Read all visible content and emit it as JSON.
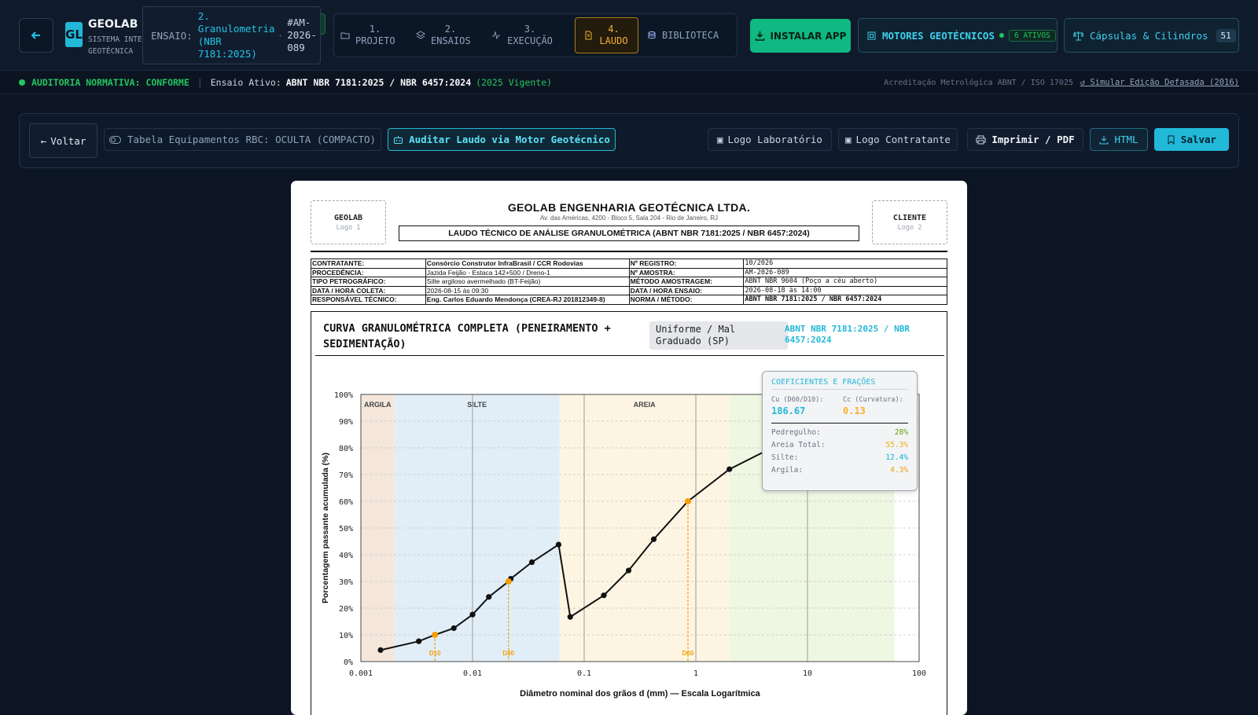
{
  "header": {
    "brand_title": "GEOLAB N",
    "brand_sub1": "SISTEMA INTE",
    "brand_sub2": "GEOTÉCNICA",
    "ensaio_label": "ENSAIO:",
    "ensaio_name": "2. Granulometria (NBR 7181:2025)",
    "ensaio_code": "#AM-2026-089",
    "steps": [
      {
        "label": "1. PROJETO"
      },
      {
        "label": "2. ENSAIOS"
      },
      {
        "label": "3. EXECUÇÃO"
      },
      {
        "label": "4. LAUDO"
      },
      {
        "label": "BIBLIOTECA"
      }
    ],
    "install_label": "INSTALAR APP",
    "motores_label": "MOTORES GEOTÉCNICOS",
    "motores_badge": "6 ATIVOS",
    "capsulas_label": "Cápsulas & Cilindros",
    "capsulas_count": "51"
  },
  "audit": {
    "status": "AUDITORIA NORMATIVA: CONFORME",
    "ensaio_ativo_label": "Ensaio Ativo:",
    "ensaio_ativo_value": "ABNT NBR 7181:2025 / NBR 6457:2024",
    "vigente": "(2025 Vigente)",
    "acreditacao": "Acreditação Metrológica ABNT / ISO 17025",
    "simular": "Simular Edição Defasada (2016)"
  },
  "toolbar": {
    "voltar": "Voltar",
    "tabela": "Tabela Equipamentos RBC: OCULTA (COMPACTO)",
    "auditar": "Auditar Laudo via Motor Geotécnico",
    "logo_lab": "Logo Laboratório",
    "logo_contr": "Logo Contratante",
    "imprimir": "Imprimir / PDF",
    "html": "HTML",
    "salvar": "Salvar"
  },
  "report": {
    "logo1_title": "GEOLAB",
    "logo1_sub": "Logo 1",
    "logo2_title": "CLIENTE",
    "logo2_sub": "Logo 2",
    "company": "GEOLAB ENGENHARIA GEOTÉCNICA LTDA.",
    "address": "Av. das Américas, 4200 - Bloco 5, Sala 204 - Rio de Janeiro, RJ",
    "doc_title": "LAUDO TÉCNICO DE ANÁLISE GRANULOMÉTRICA (ABNT NBR 7181:2025 / NBR 6457:2024)",
    "meta": [
      {
        "k1": "CONTRATANTE:",
        "v1": "Consórcio Construtor InfraBrasil / CCR Rodovias",
        "k2": "Nº REGISTRO:",
        "v2": "10/2026"
      },
      {
        "k1": "PROCEDÊNCIA:",
        "v1": "Jazida Feijão - Estaca 142+500 / Dreno-1",
        "k2": "Nº AMOSTRA:",
        "v2": "AM-2026-089"
      },
      {
        "k1": "TIPO PETROGRÁFICO:",
        "v1": "Silte argiloso avermelhado (BT-Feijão)",
        "k2": "MÉTODO AMOSTRAGEM:",
        "v2": "ABNT NBR 9604 (Poço a céu aberto)"
      },
      {
        "k1": "DATA / HORA COLETA:",
        "v1": "2026-08-15 às 09:30",
        "k2": "DATA / HORA ENSAIO:",
        "v2": "2026-08-18 às 14:00"
      },
      {
        "k1": "RESPONSÁVEL TÉCNICO:",
        "v1": "Eng. Carlos Eduardo Mendonça (CREA-RJ 201812349-8)",
        "k2": "NORMA / MÉTODO:",
        "v2": "ABNT NBR 7181:2025 / NBR 6457:2024"
      }
    ],
    "chart_title": "CURVA GRANULOMÉTRICA COMPLETA (PENEIRAMENTO + SEDIMENTAÇÃO)",
    "classification": "Uniforme / Mal Graduado (SP)",
    "chart_norm": "ABNT NBR 7181:2025 / NBR 6457:2024",
    "coef": {
      "title": "COEFICIENTES E FRAÇÕES",
      "cu_label": "Cu (D60/D10):",
      "cu_value": "186.67",
      "cc_label": "Cc (Curvatura):",
      "cc_value": "0.13",
      "fractions": [
        {
          "label": "Pedregulho:",
          "value": "28%",
          "color": "#65a30d"
        },
        {
          "label": "Areia Total:",
          "value": "55.3%",
          "color": "#eab308"
        },
        {
          "label": "Silte:",
          "value": "12.4%",
          "color": "#06b6d4"
        },
        {
          "label": "Argila:",
          "value": "4.3%",
          "color": "#f59e0b"
        }
      ]
    }
  },
  "colors": {
    "accent": "#22c3e6",
    "success": "#10b981",
    "warning": "#f5b02e",
    "d_marker": "#f59e0b"
  },
  "chart_data": {
    "type": "line",
    "title": "",
    "xlabel": "Diâmetro nominal dos grãos d (mm) — Escala Logarítmica",
    "ylabel": "Porcentagem passante acumulada (%)",
    "xscale": "log",
    "xlim": [
      0.001,
      100
    ],
    "ylim": [
      0,
      100
    ],
    "xticks": [
      {
        "v": 0.001,
        "label": "0.001"
      },
      {
        "v": 0.01,
        "label": "0.01"
      },
      {
        "v": 0.1,
        "label": "0.1"
      },
      {
        "v": 1,
        "label": "1"
      },
      {
        "v": 10,
        "label": "10"
      },
      {
        "v": 100,
        "label": "100"
      }
    ],
    "yticks": [
      {
        "v": 0,
        "label": "0%"
      },
      {
        "v": 10,
        "label": "10%"
      },
      {
        "v": 20,
        "label": "20%"
      },
      {
        "v": 30,
        "label": "30%"
      },
      {
        "v": 40,
        "label": "40%"
      },
      {
        "v": 50,
        "label": "50%"
      },
      {
        "v": 60,
        "label": "60%"
      },
      {
        "v": 70,
        "label": "70%"
      },
      {
        "v": 80,
        "label": "80%"
      },
      {
        "v": 90,
        "label": "90%"
      },
      {
        "v": 100,
        "label": "100%"
      }
    ],
    "grid": true,
    "zones": [
      {
        "name": "ARGILA",
        "from": 0.001,
        "to": 0.002,
        "color": "#f4e6da"
      },
      {
        "name": "SILTE",
        "from": 0.002,
        "to": 0.06,
        "color": "#e1eef8"
      },
      {
        "name": "AREIA",
        "from": 0.06,
        "to": 2,
        "color": "#fdf5e2"
      },
      {
        "name": "",
        "from": 2,
        "to": 60,
        "color": "#eef7e2"
      }
    ],
    "series": [
      {
        "points": [
          [
            0.0015,
            4.3
          ],
          [
            0.0033,
            7.6
          ],
          [
            0.0046,
            10
          ],
          [
            0.0068,
            12.5
          ],
          [
            0.01,
            17.6
          ],
          [
            0.014,
            24.2
          ],
          [
            0.021,
            30
          ],
          [
            0.022,
            31
          ],
          [
            0.034,
            37.2
          ],
          [
            0.059,
            43.8
          ],
          [
            0.075,
            16.7
          ],
          [
            0.15,
            24.8
          ],
          [
            0.25,
            34.1
          ],
          [
            0.42,
            45.8
          ],
          [
            0.85,
            60
          ],
          [
            2.0,
            72
          ],
          [
            4.8,
            80
          ]
        ]
      }
    ],
    "markers": [
      {
        "label": "D10",
        "x": 0.0046,
        "y": 10
      },
      {
        "label": "D30",
        "x": 0.021,
        "y": 30
      },
      {
        "label": "D60",
        "x": 0.85,
        "y": 60
      }
    ]
  }
}
